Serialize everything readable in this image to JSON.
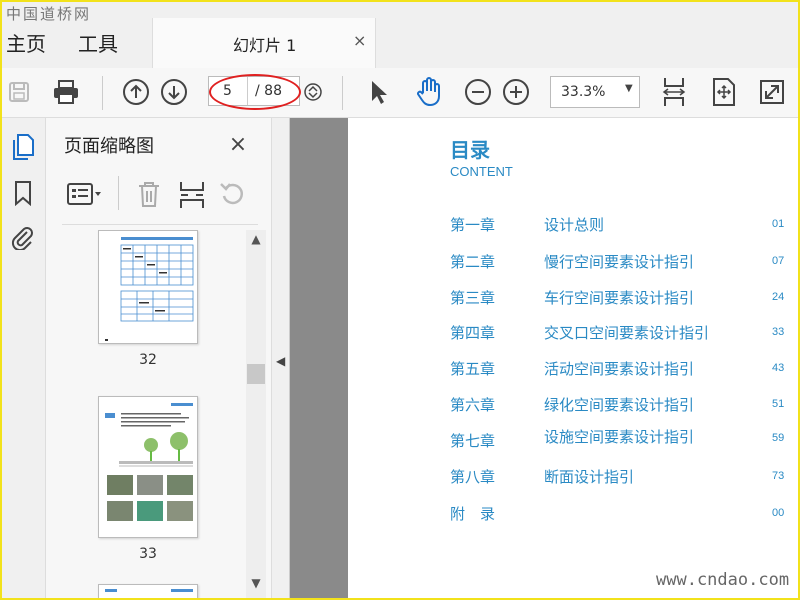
{
  "watermark_top": "中国道桥网",
  "watermark_bottom": "www.cndao.com",
  "menu": {
    "home": "主页",
    "tools": "工具"
  },
  "tab": {
    "label": "幻灯片 1",
    "close": "×"
  },
  "toolbar": {
    "current_page": "5",
    "total_pages": "/ 88",
    "zoom": "33.3%",
    "zoom_caret": "▼"
  },
  "panel": {
    "title": "页面缩略图",
    "close": "×",
    "thumbnails": [
      {
        "label": "32"
      },
      {
        "label": "33"
      }
    ],
    "scroll_up": "▲",
    "scroll_down": "▼"
  },
  "collapse_arrow": "◀",
  "toc": {
    "title": "目录",
    "subtitle": "CONTENT",
    "rows": [
      {
        "chapter": "第一章",
        "name": "设计总则",
        "page": "01"
      },
      {
        "chapter": "第二章",
        "name": "慢行空间要素设计指引",
        "page": "07"
      },
      {
        "chapter": "第三章",
        "name": "车行空间要素设计指引",
        "page": "24"
      },
      {
        "chapter": "第四章",
        "name": "交叉口空间要素设计指引",
        "page": "33"
      },
      {
        "chapter": "第五章",
        "name": "活动空间要素设计指引",
        "page": "43"
      },
      {
        "chapter": "第六章",
        "name": "绿化空间要素设计指引",
        "page": "51"
      },
      {
        "chapter": "第七章",
        "name": "设施空间要素设计指引",
        "page": "59"
      },
      {
        "chapter": "第八章",
        "name": "断面设计指引",
        "page": "73"
      },
      {
        "chapter": "附　录",
        "name": "",
        "page": "00"
      }
    ]
  },
  "colors": {
    "accent": "#2a8ac4",
    "frame": "#f2e21b",
    "annotation": "#e02020"
  }
}
